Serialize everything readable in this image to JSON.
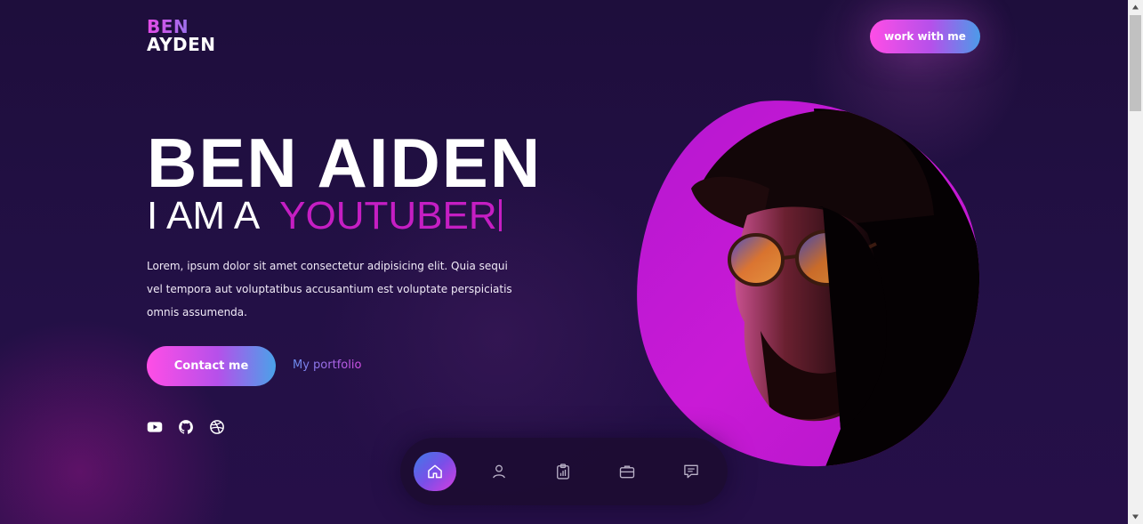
{
  "logo": {
    "line1": "BEN",
    "line2": "AYDEN"
  },
  "header": {
    "cta_label": "work with me"
  },
  "hero": {
    "name": "BEN AIDEN",
    "role_prefix": "I AM A",
    "role_typed": "YOUTUBER",
    "description": "Lorem, ipsum dolor sit amet consectetur adipisicing elit. Quia sequi vel tempora aut voluptatibus accusantium est voluptate perspiciatis omnis assumenda.",
    "primary_button": "Contact me",
    "secondary_link": "My portfolio"
  },
  "social": [
    {
      "icon": "youtube-icon"
    },
    {
      "icon": "github-icon"
    },
    {
      "icon": "dribbble-icon"
    }
  ],
  "bottom_nav": [
    {
      "icon": "home-icon",
      "active": true
    },
    {
      "icon": "user-icon",
      "active": false
    },
    {
      "icon": "clipboard-chart-icon",
      "active": false
    },
    {
      "icon": "briefcase-icon",
      "active": false
    },
    {
      "icon": "message-icon",
      "active": false
    }
  ],
  "colors": {
    "background": "#1f0f3e",
    "accent_pink": "#ff4ee6",
    "accent_blue": "#4c9be9",
    "role_text": "#c51ec3",
    "blob": "#c21bd4"
  }
}
